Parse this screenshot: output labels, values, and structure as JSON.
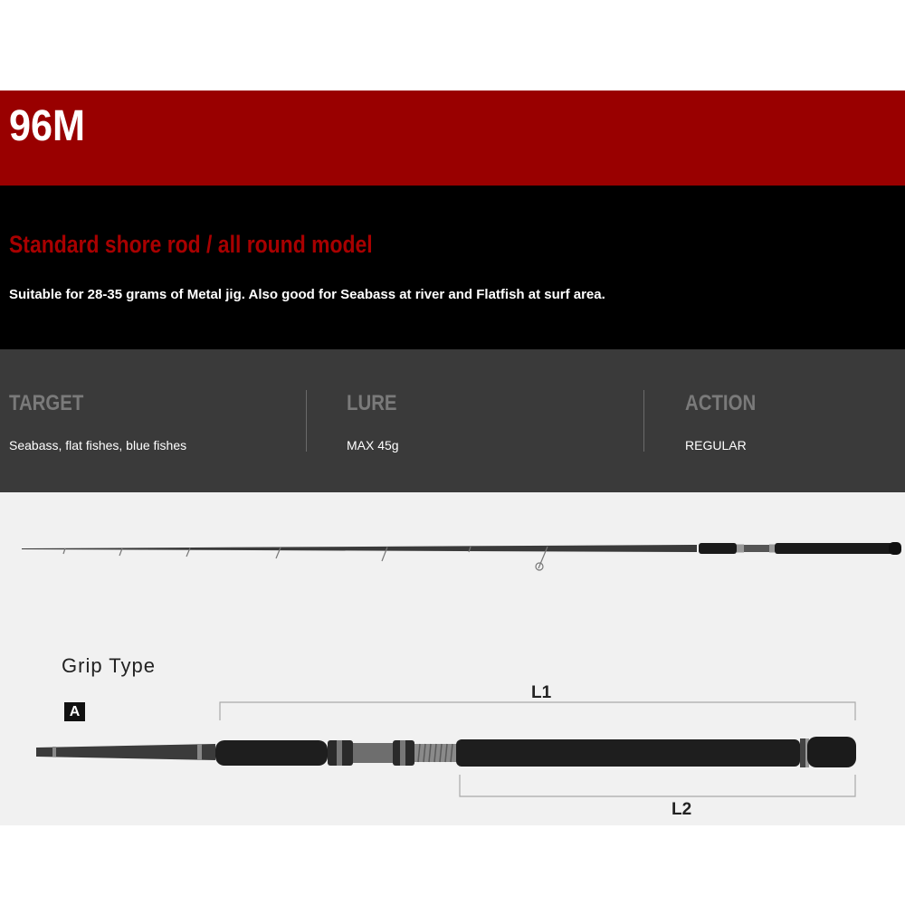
{
  "model": "96M",
  "headline": "Standard shore rod / all round model",
  "description": "Suitable for 28-35 grams of Metal jig. Also good for Seabass at river and Flatfish at surf area.",
  "specs": {
    "target": {
      "label": "TARGET",
      "value": "Seabass, flat fishes, blue fishes"
    },
    "lure": {
      "label": "LURE",
      "value": "MAX 45g"
    },
    "action": {
      "label": "ACTION",
      "value": "REGULAR"
    }
  },
  "grip": {
    "title": "Grip Type",
    "badge": "A",
    "dimension_labels": {
      "l1": "L1",
      "l2": "L2"
    }
  },
  "colors": {
    "title_band": "#990000",
    "headline": "#a80000",
    "desc_band": "#000000",
    "spec_band": "#3a3a3a",
    "spec_label": "#7a7a7a",
    "figure_band": "#f1f1f1"
  }
}
